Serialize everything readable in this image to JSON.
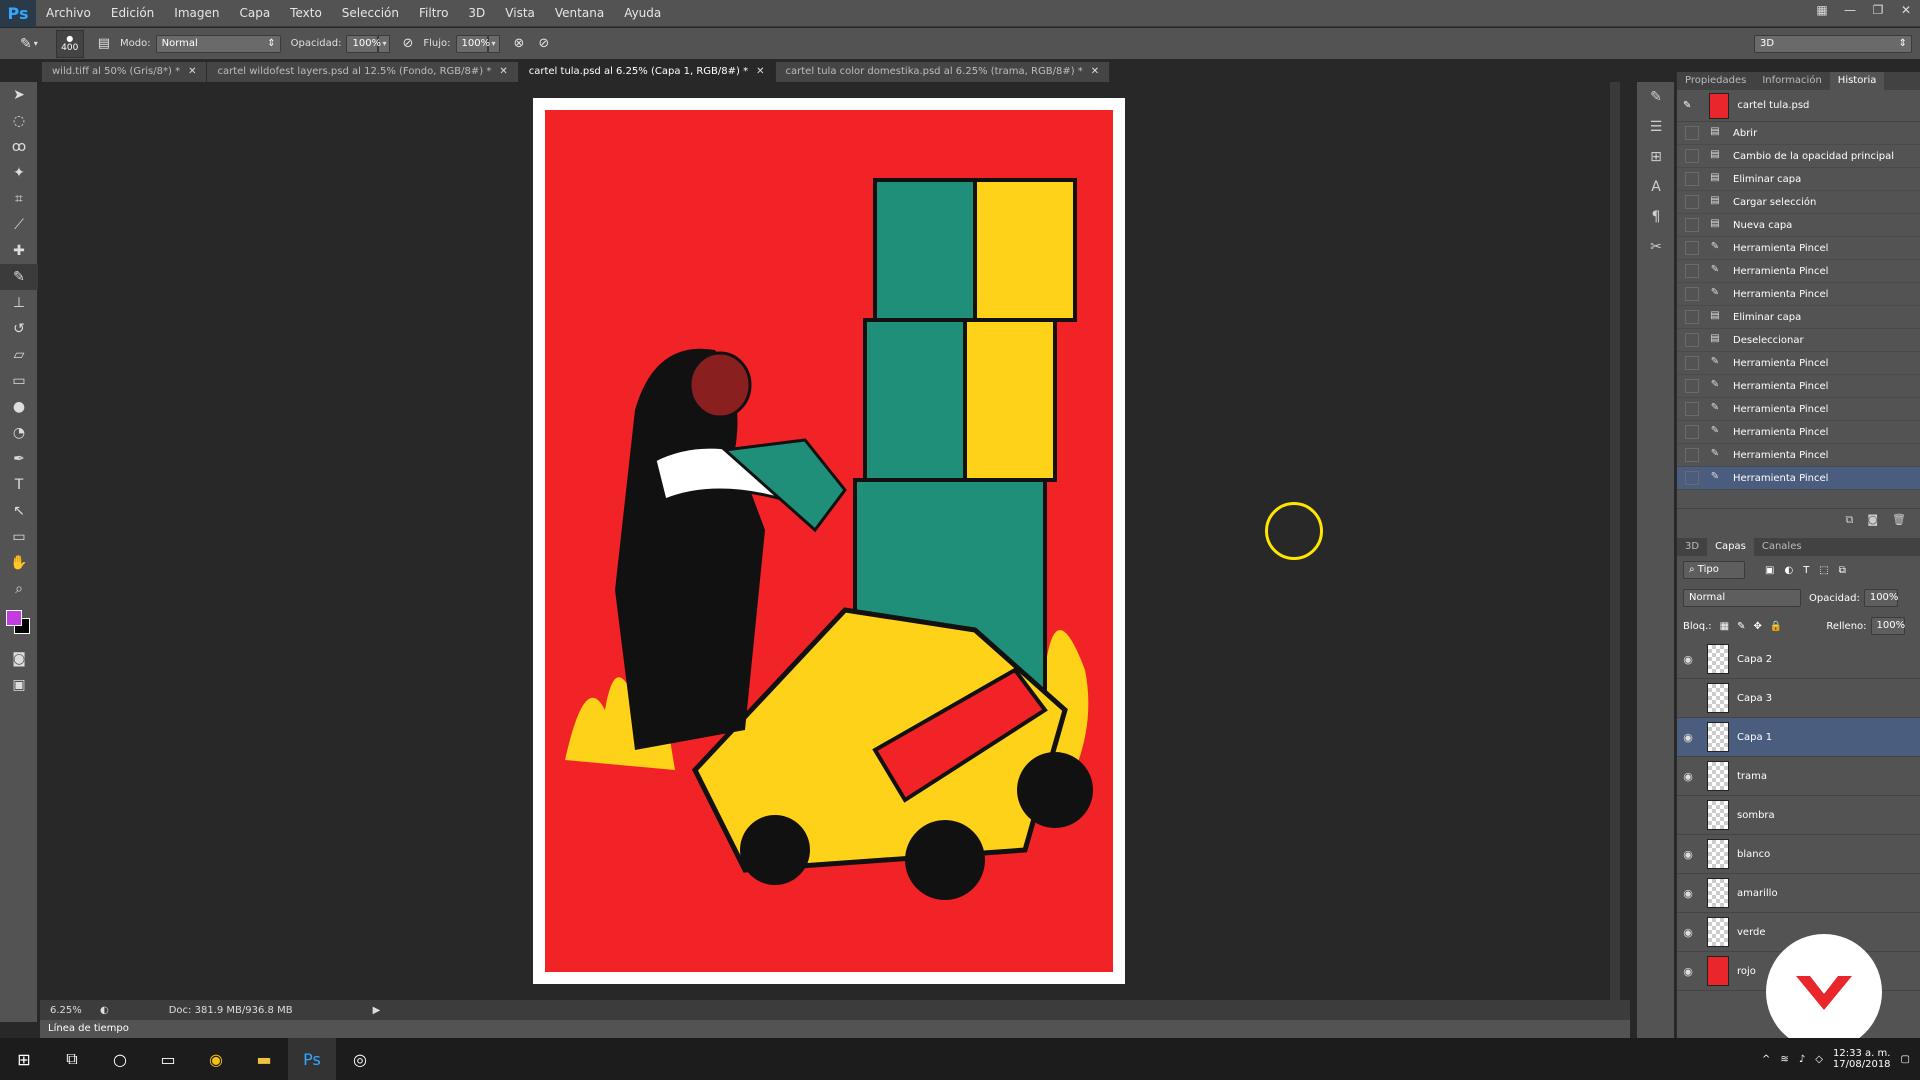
{
  "app": {
    "logo": "Ps"
  },
  "menu": [
    "Archivo",
    "Edición",
    "Imagen",
    "Capa",
    "Texto",
    "Selección",
    "Filtro",
    "3D",
    "Vista",
    "Ventana",
    "Ayuda"
  ],
  "options": {
    "brush_size": "400",
    "mode_label": "Modo:",
    "mode_value": "Normal",
    "opacity_label": "Opacidad:",
    "opacity_value": "100%",
    "flow_label": "Flujo:",
    "flow_value": "100%",
    "workspace": "3D"
  },
  "tabs": [
    {
      "label": "wild.tiff al 50% (Gris/8*) *"
    },
    {
      "label": "cartel wildofest layers.psd al 12.5% (Fondo, RGB/8#) *"
    },
    {
      "label": "cartel tula.psd al 6.25% (Capa 1, RGB/8#) *",
      "active": true
    },
    {
      "label": "cartel tula color domestika.psd al 6.25% (trama, RGB/8#) *"
    }
  ],
  "status": {
    "zoom": "6.25%",
    "doc": "Doc: 381.9 MB/936.8 MB",
    "timeline": "Línea de tiempo"
  },
  "right_panel": {
    "tabs": [
      "Propiedades",
      "Información",
      "Historia"
    ],
    "history_doc": "cartel tula.psd",
    "history": [
      {
        "label": "Abrir",
        "icon": "doc-icon"
      },
      {
        "label": "Cambio de la opacidad principal",
        "icon": "doc-icon"
      },
      {
        "label": "Eliminar capa",
        "icon": "doc-icon"
      },
      {
        "label": "Cargar selección",
        "icon": "doc-icon"
      },
      {
        "label": "Nueva capa",
        "icon": "doc-icon"
      },
      {
        "label": "Herramienta Pincel",
        "icon": "brush-icon"
      },
      {
        "label": "Herramienta Pincel",
        "icon": "brush-icon"
      },
      {
        "label": "Herramienta Pincel",
        "icon": "brush-icon"
      },
      {
        "label": "Eliminar capa",
        "icon": "doc-icon"
      },
      {
        "label": "Deseleccionar",
        "icon": "doc-icon"
      },
      {
        "label": "Herramienta Pincel",
        "icon": "brush-icon"
      },
      {
        "label": "Herramienta Pincel",
        "icon": "brush-icon"
      },
      {
        "label": "Herramienta Pincel",
        "icon": "brush-icon"
      },
      {
        "label": "Herramienta Pincel",
        "icon": "brush-icon"
      },
      {
        "label": "Herramienta Pincel",
        "icon": "brush-icon"
      },
      {
        "label": "Herramienta Pincel",
        "icon": "brush-icon",
        "selected": true
      }
    ],
    "layer_tabs": [
      "3D",
      "Capas",
      "Canales"
    ],
    "layer_filter": "Tipo",
    "blend_mode": "Normal",
    "opacity_label": "Opacidad:",
    "opacity_value": "100%",
    "lock_label": "Bloq.:",
    "fill_label": "Relleno:",
    "fill_value": "100%",
    "layers": [
      {
        "name": "Capa 2",
        "visible": true
      },
      {
        "name": "Capa 3",
        "visible": false
      },
      {
        "name": "Capa 1",
        "visible": true,
        "selected": true
      },
      {
        "name": "trama",
        "visible": true
      },
      {
        "name": "sombra",
        "visible": false
      },
      {
        "name": "blanco",
        "visible": true
      },
      {
        "name": "amarillo",
        "visible": true
      },
      {
        "name": "verde",
        "visible": true
      },
      {
        "name": "rojo",
        "visible": true
      }
    ]
  },
  "taskbar": {
    "time": "12:33 a. m.",
    "date": "17/08/2018"
  },
  "colors": {
    "poster_red": "#f22326",
    "teal": "#1f8f7a",
    "yellow": "#ffd21a",
    "foreground": "#c23de0"
  }
}
